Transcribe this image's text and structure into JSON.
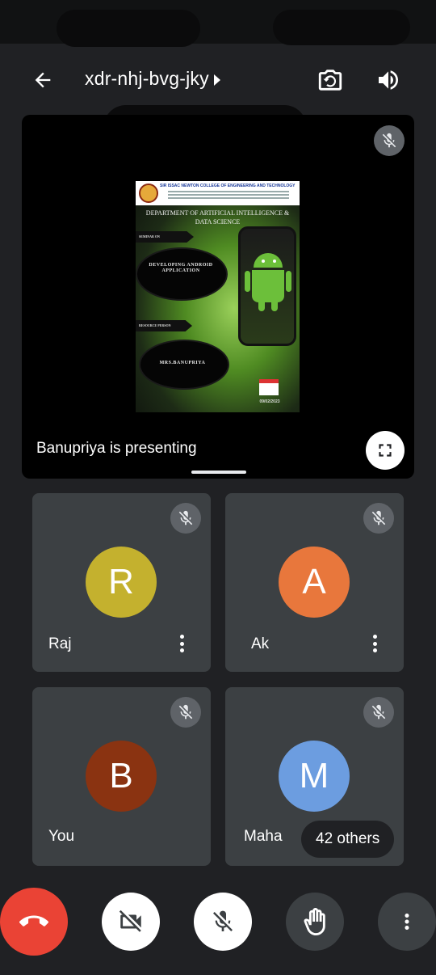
{
  "header": {
    "meeting_code": "xdr-nhj-bvg-jky",
    "icons": {
      "back": "arrow-back-icon",
      "switch_camera": "switch-camera-icon",
      "speaker": "volume-icon",
      "caret": "caret-right-icon"
    }
  },
  "presentation": {
    "presenter_label": "Banupriya is presenting",
    "mic_muted": true,
    "slide": {
      "college": "SIR ISSAC NEWTON COLLEGE OF ENGINEERING AND TECHNOLOGY",
      "department": "DEPARTMENT OF ARTIFICIAL INTELLIGENCE & DATA SCIENCE",
      "seminar_on_label": "SEMINAR ON",
      "seminar_title": "DEVELOPING ANDROID APPLICATION",
      "resource_person_label": "RESOURCE PERSON",
      "resource_person": "MRS.BANUPRIYA",
      "date": "09/02/2023"
    }
  },
  "participants": [
    {
      "name": "Raj",
      "initial": "R",
      "color": "#c4b12e",
      "mic_muted": true
    },
    {
      "name": "Ak",
      "initial": "A",
      "color": "#e8773c",
      "mic_muted": true
    },
    {
      "name": "You",
      "initial": "B",
      "color": "#8a3311",
      "mic_muted": true
    },
    {
      "name": "Maha",
      "initial": "M",
      "color": "#6c9de0",
      "mic_muted": true
    }
  ],
  "others_chip": "42 others",
  "controls": {
    "end_call": "end-call-icon",
    "camera": "camera-off-icon",
    "mic": "mic-off-icon",
    "raise_hand": "raise-hand-icon",
    "more": "more-vert-icon"
  },
  "colors": {
    "background": "#202124",
    "tile": "#3c4043",
    "end_call": "#ea4335"
  }
}
